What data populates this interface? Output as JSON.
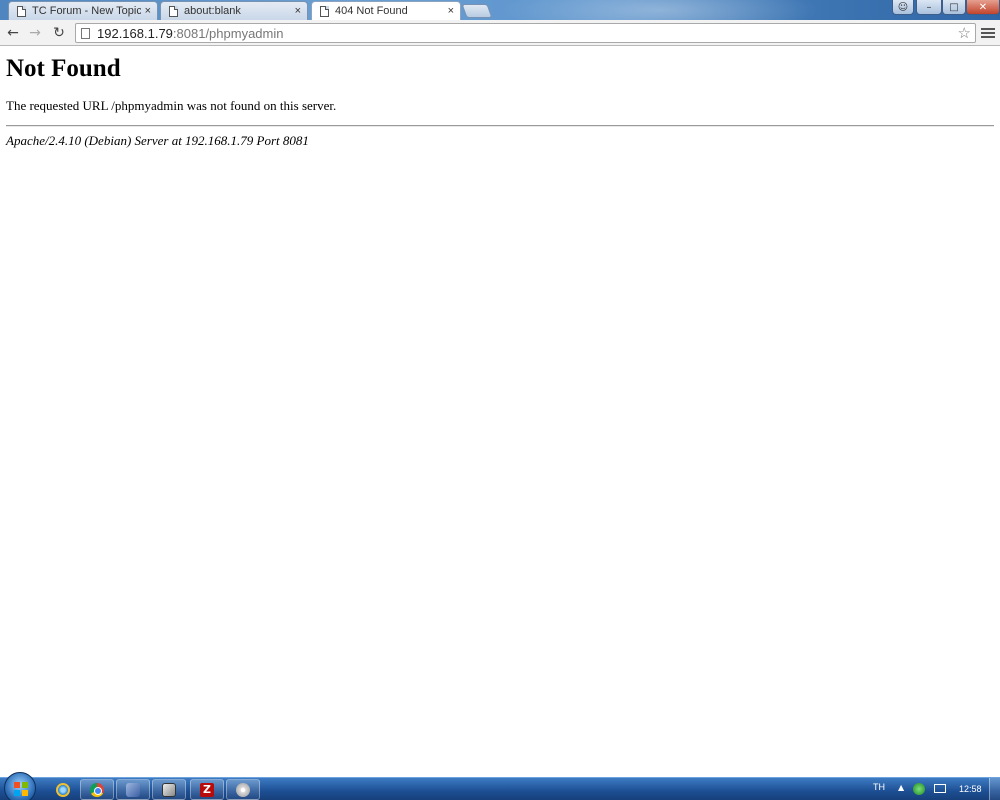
{
  "tabs": [
    {
      "label": "TC Forum - New Topic :: el",
      "active": false
    },
    {
      "label": "about:blank",
      "active": false
    },
    {
      "label": "404 Not Found",
      "active": true
    }
  ],
  "tab_close_glyph": "×",
  "window_controls": {
    "minimize": "–",
    "maximize": "□",
    "close": "✕"
  },
  "toolbar": {
    "back_glyph": "←",
    "forward_glyph": "→",
    "reload_glyph": "↻",
    "star_glyph": "☆"
  },
  "address": {
    "host": "192.168.1.79",
    "rest": ":8081/phpmyadmin"
  },
  "page": {
    "heading": "Not Found",
    "message": "The requested URL /phpmyadmin was not found on this server.",
    "signature": "Apache/2.4.10 (Debian) Server at 192.168.1.79 Port 8081"
  },
  "taskbar": {
    "pinned": [
      "ie-icon",
      "chrome-icon",
      "virtualbox-icon",
      "putty-icon",
      "filezilla-icon",
      "disc-icon"
    ],
    "filezilla_glyph": "Z",
    "language": "TH",
    "tray_arrow": "▲",
    "clock": "12:58"
  },
  "colors": {
    "titlebar": "#4f86bf",
    "taskbar": "#1d4f94",
    "close_button": "#c2432b"
  }
}
